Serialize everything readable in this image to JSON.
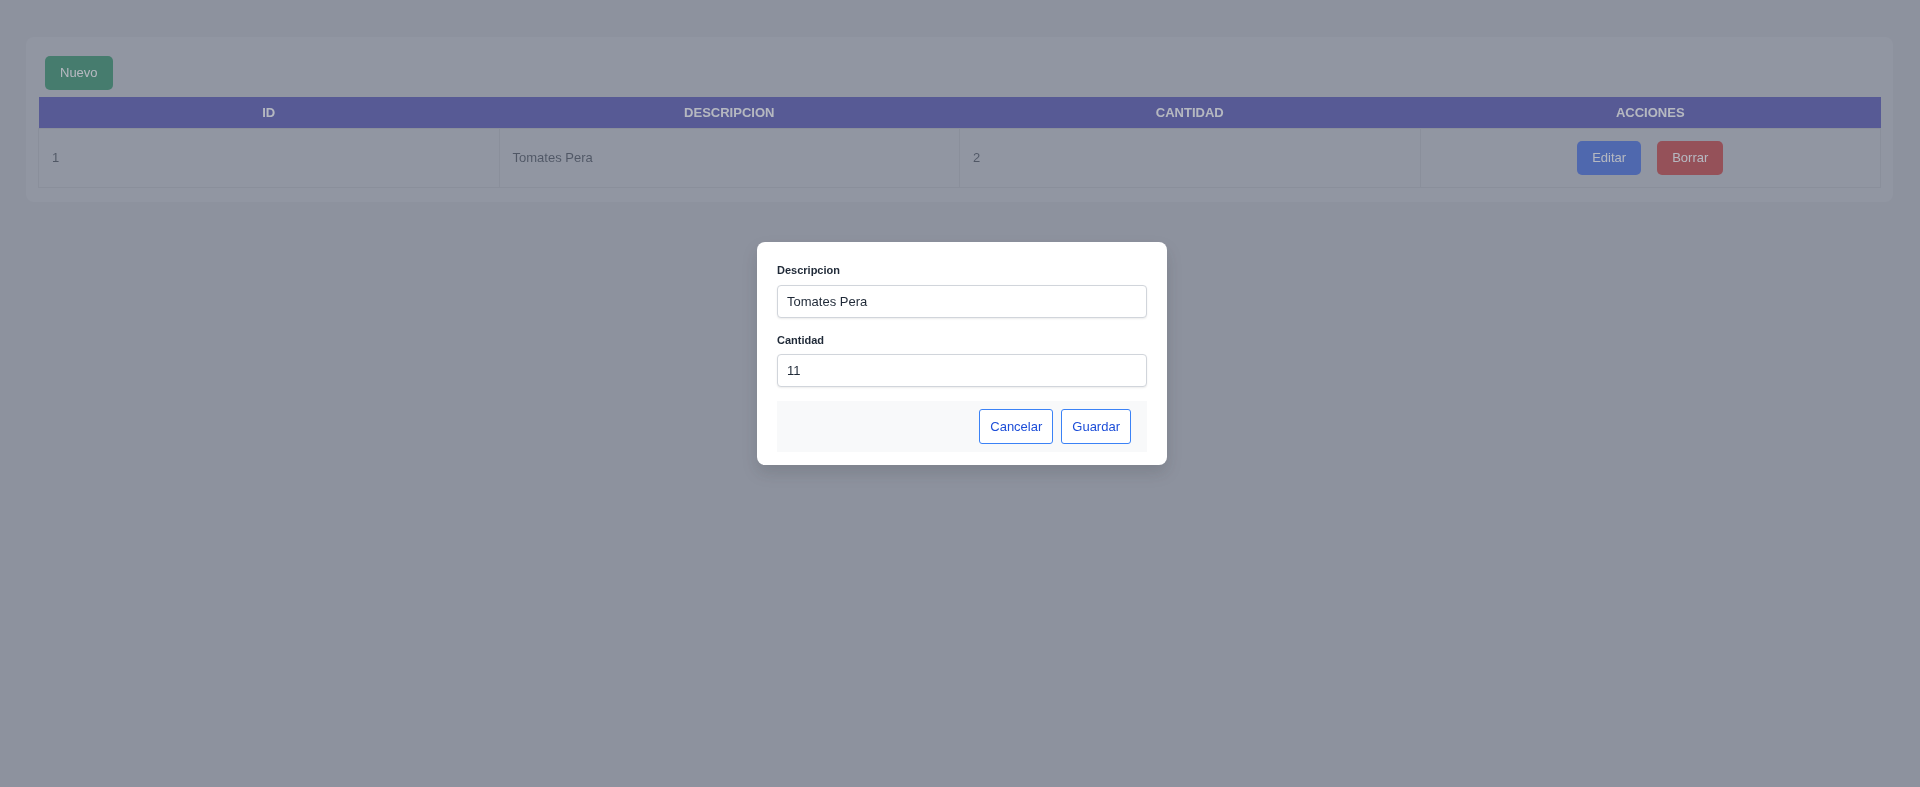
{
  "new_button": "Nuevo",
  "table": {
    "columns": [
      "ID",
      "DESCRIPCION",
      "CANTIDAD",
      "ACCIONES"
    ],
    "rows": [
      {
        "cells": [
          "1",
          "Tomates Pera",
          "2"
        ],
        "actions": [
          {
            "label": "Editar",
            "kind": "edit"
          },
          {
            "label": "Borrar",
            "kind": "delete"
          }
        ]
      }
    ]
  },
  "modal": {
    "fields": [
      {
        "label": "Descripcion",
        "value": "Tomates Pera"
      },
      {
        "label": "Cantidad",
        "value": "11"
      }
    ],
    "buttons": [
      "Cancelar",
      "Guardar"
    ]
  }
}
